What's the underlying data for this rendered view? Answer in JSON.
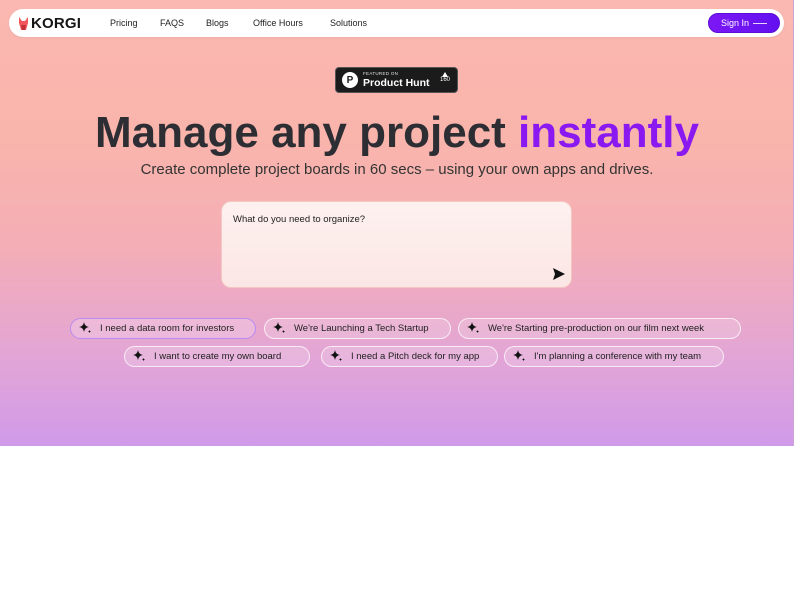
{
  "nav": {
    "logo": "KORGI",
    "links": [
      "Pricing",
      "FAQS",
      "Blogs",
      "Office Hours",
      "Solutions"
    ],
    "sign_in": "Sign In"
  },
  "product_hunt": {
    "featured": "FEATURED ON",
    "name": "Product Hunt",
    "votes": "160"
  },
  "hero": {
    "title_main": "Manage any project",
    "title_accent": "instantly",
    "subtitle": "Create complete project boards in 60 secs – using your own apps and drives."
  },
  "prompt": {
    "placeholder": "What do you need to organize?"
  },
  "suggestions": [
    "I need a data room for investors",
    "We're Launching a Tech Startup",
    "We're Starting pre-production on our film next week",
    "I want to create my own board",
    "I need a Pitch deck for my app",
    "I'm planning a conference with my team"
  ],
  "colors": {
    "accent": "#8a18f0",
    "button": "#6c14f2",
    "text_dark": "#2d2d34"
  },
  "icons": {
    "logo": "korgi-dog-icon",
    "send": "send-arrow-icon",
    "suggestion": "sparkle-icon"
  }
}
